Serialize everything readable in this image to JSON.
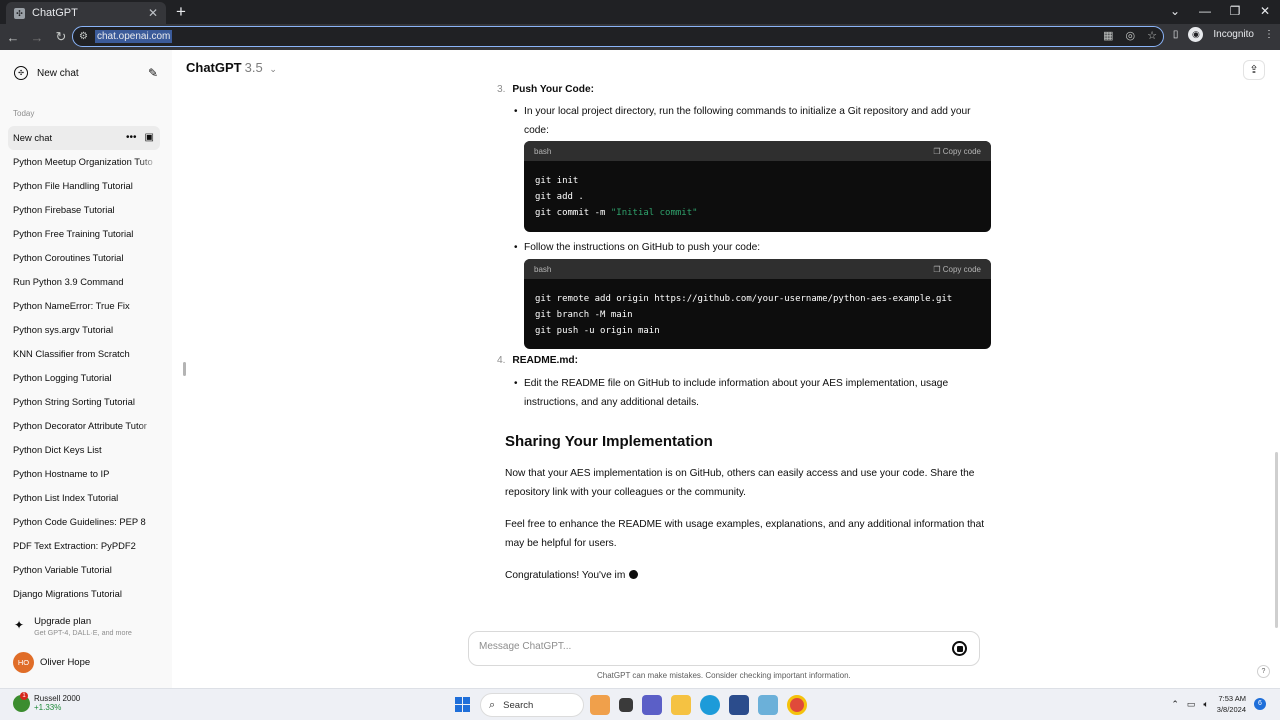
{
  "browser": {
    "tab_title": "ChatGPT",
    "favicon": "chatgpt-favicon",
    "url": "chat.openai.com",
    "incognito_label": "Incognito"
  },
  "sidebar": {
    "new_chat_label": "New chat",
    "section_today": "Today",
    "items": [
      {
        "label": "New chat",
        "active": true
      },
      {
        "label": "Python Meetup Organization Tuto",
        "fade": true
      },
      {
        "label": "Python File Handling Tutorial"
      },
      {
        "label": "Python Firebase Tutorial"
      },
      {
        "label": "Python Free Training Tutorial"
      },
      {
        "label": "Python Coroutines Tutorial"
      },
      {
        "label": "Run Python 3.9 Command"
      },
      {
        "label": "Python NameError: True Fix"
      },
      {
        "label": "Python sys.argv Tutorial"
      },
      {
        "label": "KNN Classifier from Scratch"
      },
      {
        "label": "Python Logging Tutorial"
      },
      {
        "label": "Python String Sorting Tutorial"
      },
      {
        "label": "Python Decorator Attribute Tutor",
        "fade": true
      },
      {
        "label": "Python Dict Keys List"
      },
      {
        "label": "Python Hostname to IP"
      },
      {
        "label": "Python List Index Tutorial"
      },
      {
        "label": "Python Code Guidelines: PEP 8"
      },
      {
        "label": "PDF Text Extraction: PyPDF2"
      },
      {
        "label": "Python Variable Tutorial"
      },
      {
        "label": "Django Migrations Tutorial"
      }
    ],
    "upgrade_title": "Upgrade plan",
    "upgrade_subtitle": "Get GPT-4, DALL·E, and more",
    "user_initials": "HO",
    "user_name": "Oliver Hope"
  },
  "header": {
    "model_name": "ChatGPT",
    "model_version": "3.5"
  },
  "message": {
    "step3_num": "3.",
    "step3_title": "Push Your Code:",
    "bullet1": "In your local project directory, run the following commands to initialize a Git repository and add your code:",
    "code1_lang": "bash",
    "copy_label": "Copy code",
    "code1_line1": "git init",
    "code1_line2": "git add .",
    "code1_line3_cmd": "git commit -m ",
    "code1_line3_str": "\"Initial commit\"",
    "bullet2": "Follow the instructions on GitHub to push your code:",
    "code2_lang": "bash",
    "code2_line1": "git remote add origin https://github.com/your-username/python-aes-example.git",
    "code2_line2": "git branch -M main",
    "code2_line3": "git push -u origin main",
    "step4_num": "4.",
    "step4_title": "README.md:",
    "bullet3": "Edit the README file on GitHub to include information about your AES implementation, usage instructions, and any additional details.",
    "heading": "Sharing Your Implementation",
    "para1": "Now that your AES implementation is on GitHub, others can easily access and use your code. Share the repository link with your colleagues or the community.",
    "para2": "Feel free to enhance the README with usage examples, explanations, and any additional information that may be helpful for users.",
    "para3": "Congratulations! You've im"
  },
  "composer": {
    "placeholder": "Message ChatGPT...",
    "disclaimer": "ChatGPT can make mistakes. Consider checking important information."
  },
  "taskbar": {
    "ticker_name": "Russell 2000",
    "ticker_change": "+1.33%",
    "ticker_badge": "1",
    "search_label": "Search",
    "time": "7:53 AM",
    "date": "3/8/2024",
    "notification_count": "6"
  }
}
